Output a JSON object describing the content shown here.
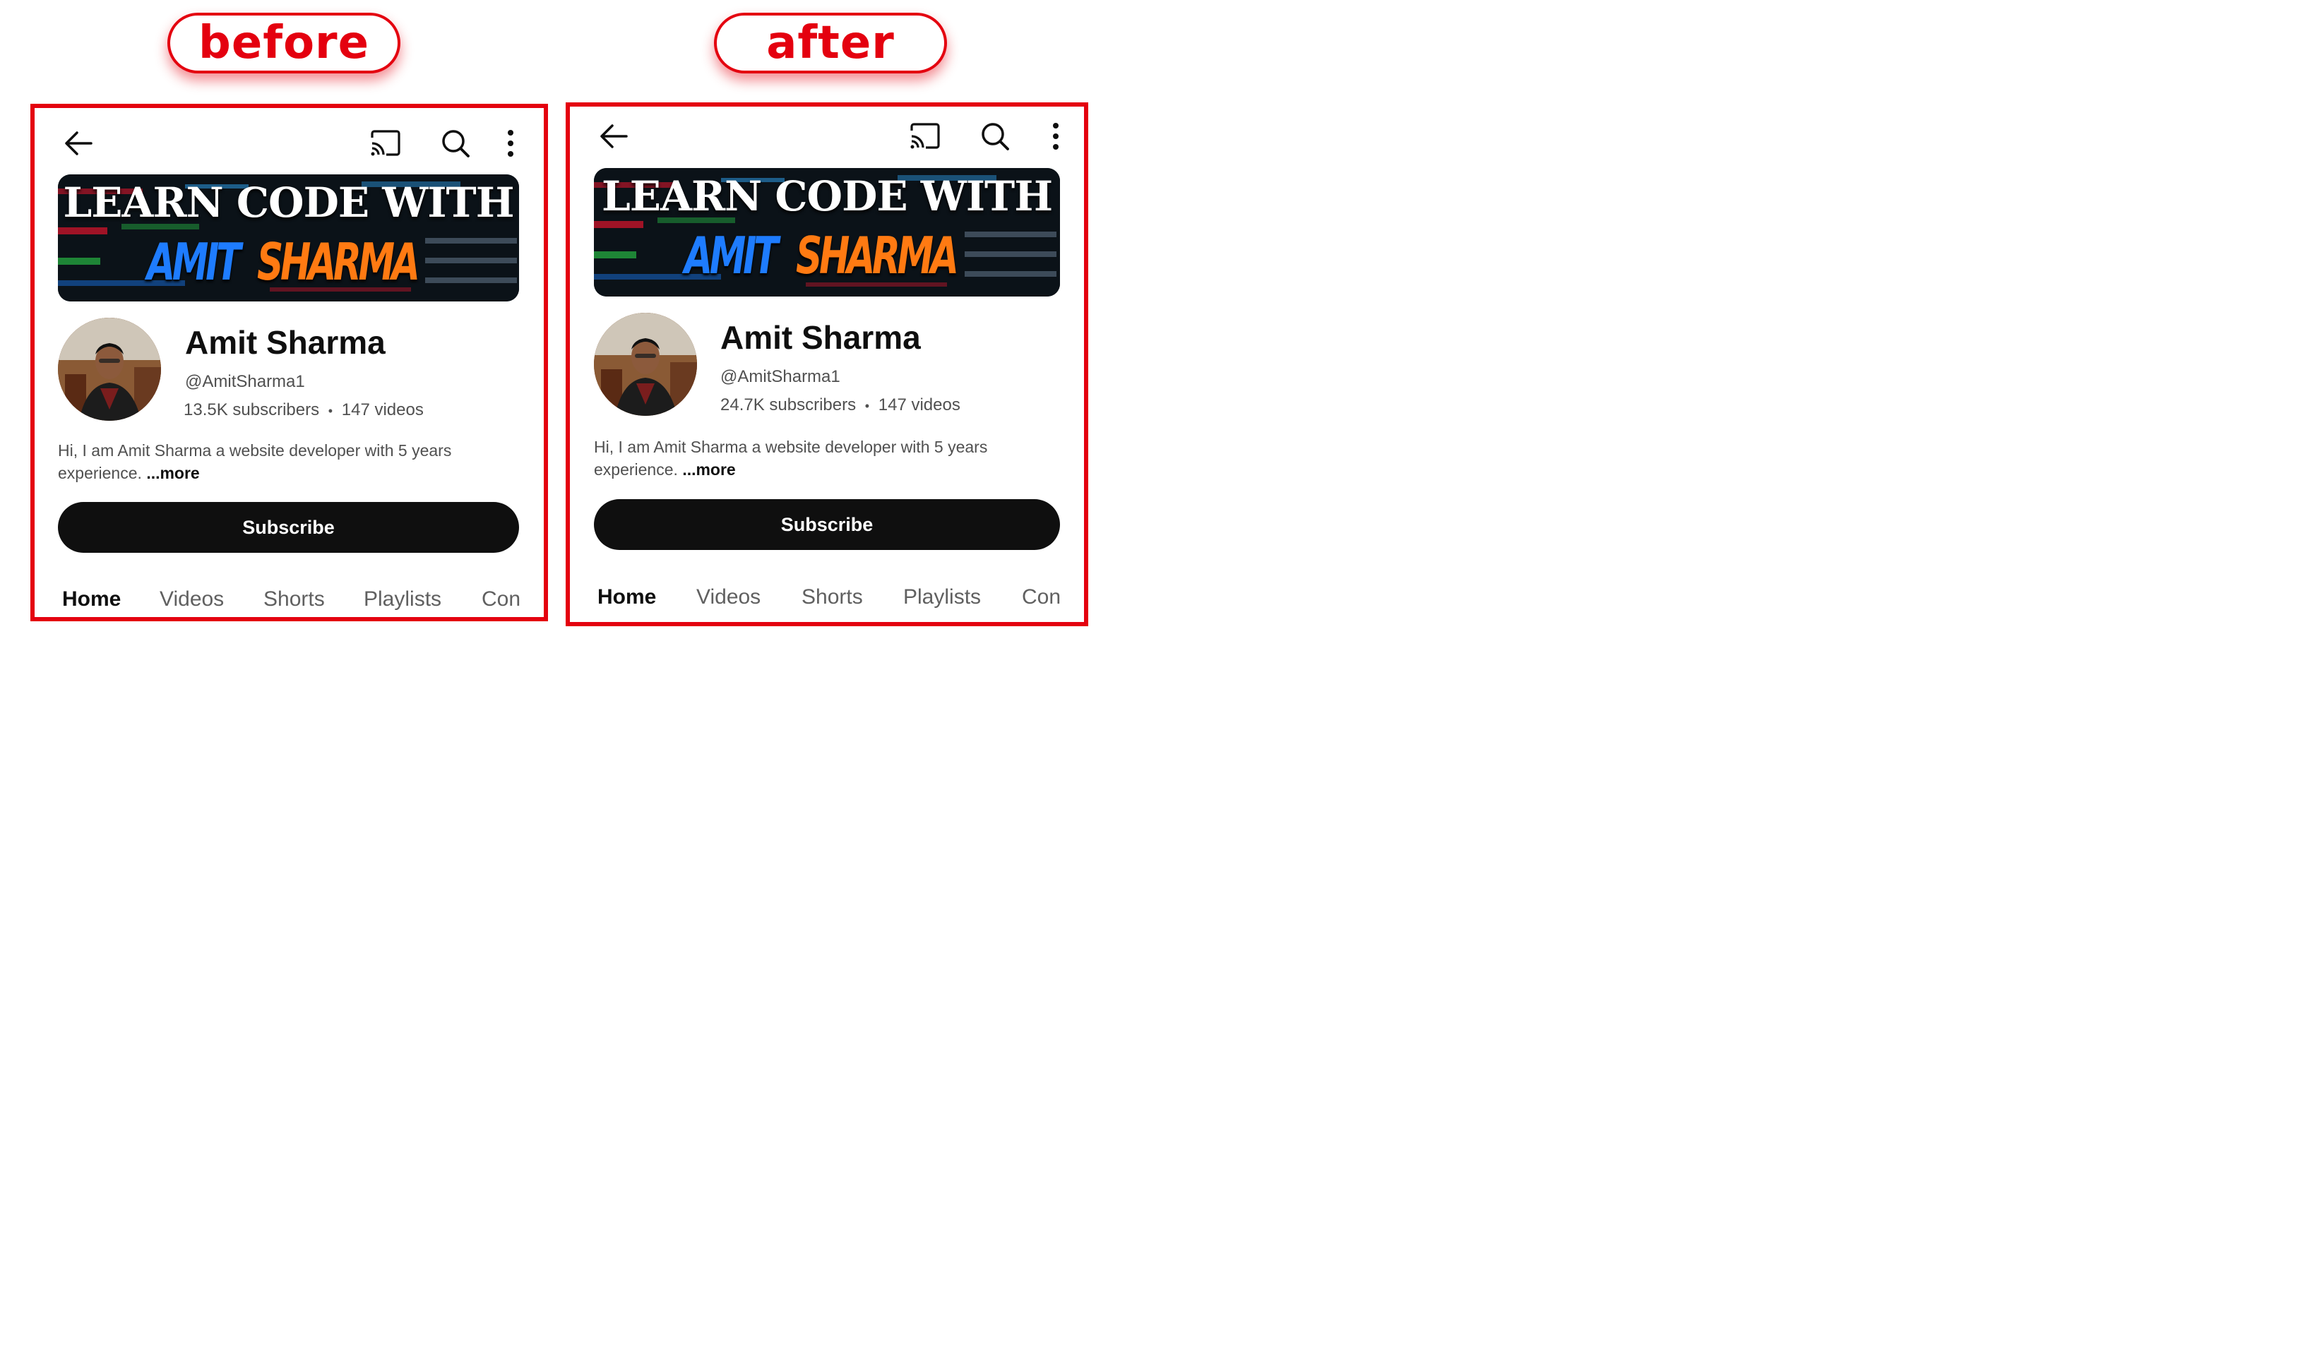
{
  "labels": {
    "before": "before",
    "after": "after"
  },
  "colors": {
    "accent": "#e4000f",
    "subscribe_bg": "#0f0f0f",
    "banner_blue": "#1e7cff",
    "banner_orange": "#ff7a12"
  },
  "icons": {
    "back": "arrow-left-icon",
    "cast": "cast-icon",
    "search": "search-icon",
    "menu": "more-vert-icon"
  },
  "before": {
    "banner": {
      "line1": "LEARN CODE WITH",
      "first": "AMIT",
      "last": "SHARMA"
    },
    "channel_name": "Amit Sharma",
    "handle": "@AmitSharma1",
    "subscribers": "13.5K subscribers",
    "separator": "•",
    "videos": "147 videos",
    "description": "Hi, I am Amit Sharma a website developer with 5 years",
    "description2": "experience.",
    "more": "...more",
    "subscribe": "Subscribe",
    "tabs": [
      "Home",
      "Videos",
      "Shorts",
      "Playlists",
      "Con"
    ]
  },
  "after": {
    "banner": {
      "line1": "LEARN CODE WITH",
      "first": "AMIT",
      "last": "SHARMA"
    },
    "channel_name": "Amit Sharma",
    "handle": "@AmitSharma1",
    "subscribers": "24.7K subscribers",
    "separator": "•",
    "videos": "147 videos",
    "description": "Hi, I am Amit Sharma a website developer with 5 years",
    "description2": "experience.",
    "more": "...more",
    "subscribe": "Subscribe",
    "tabs": [
      "Home",
      "Videos",
      "Shorts",
      "Playlists",
      "Con"
    ]
  }
}
